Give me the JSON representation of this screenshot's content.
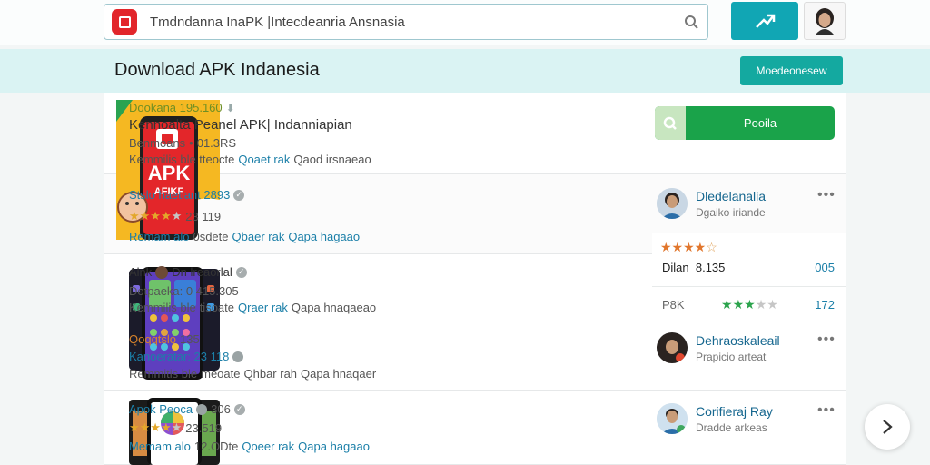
{
  "search": {
    "value": "Tmdndanna InaPK |Intecdeanria Ansnasia"
  },
  "page_title": "Download APK Indanesia",
  "band_button": "Moedeonesew",
  "colors": {
    "accent": "#11a6b4",
    "install": "#1aa34a",
    "link": "#1b7fa8",
    "star": "#e3a72a"
  },
  "rows": [
    {
      "line1": "Dookana 195.160",
      "line2": "Kennoalta Peanel APK| Indanniapian",
      "line3a": "Benmoans",
      "line3b": "01.3RS",
      "line4a": "Kemmilis ble tteocte",
      "line4b": "Qoaet rak",
      "line4c": "Qaod irsnaeao"
    },
    {
      "line1": "Stslo haetiant 2893",
      "rating": "23 119",
      "line3a": "Remam alo",
      "line3b": "0sdete",
      "line3c": "Qbaer rak",
      "line3d": "Qapa hagaao"
    },
    {
      "line1a": "Alnk",
      "line1b": "Dn lreaorlal",
      "line2": "Dotpaeka: 0 415.305",
      "line3a": "Kemmilis ble",
      "line3b": "tisoate",
      "line3c": "Qraer rak",
      "line3d": "Qapa hnaqaeao",
      "line4a": "Qoqqtslo",
      "line4b": "135",
      "line5": "Kanoeratar: 23 118",
      "line6a": "Remmitis ble",
      "line6b": "meoate",
      "line6c": "Qhbar rah",
      "line6d": "Qapa hnaqaer"
    },
    {
      "line1": "Apok Peoca",
      "line1b": "306",
      "rating": "23.519",
      "line3a": "Memam alo",
      "line3b": "12.ODte",
      "line3c": "Qoeer rak",
      "line3d": "Qapa hagaao"
    }
  ],
  "install_button": "Pooila",
  "users": [
    {
      "name": "Dledelanalia",
      "sub": "Dgaiko iriande"
    },
    {
      "name": "Dehraoskaleail",
      "sub": "Prapicio arteat"
    },
    {
      "name": "Corifieraj Ray",
      "sub": "Dradde arkeas"
    }
  ],
  "side_box": {
    "label": "Dilan",
    "value": "8.135",
    "count": "005",
    "label2": "P8K",
    "count2": "172"
  },
  "icons": {
    "next": "chevron-right-icon",
    "search": "search-icon",
    "share": "share-icon"
  }
}
